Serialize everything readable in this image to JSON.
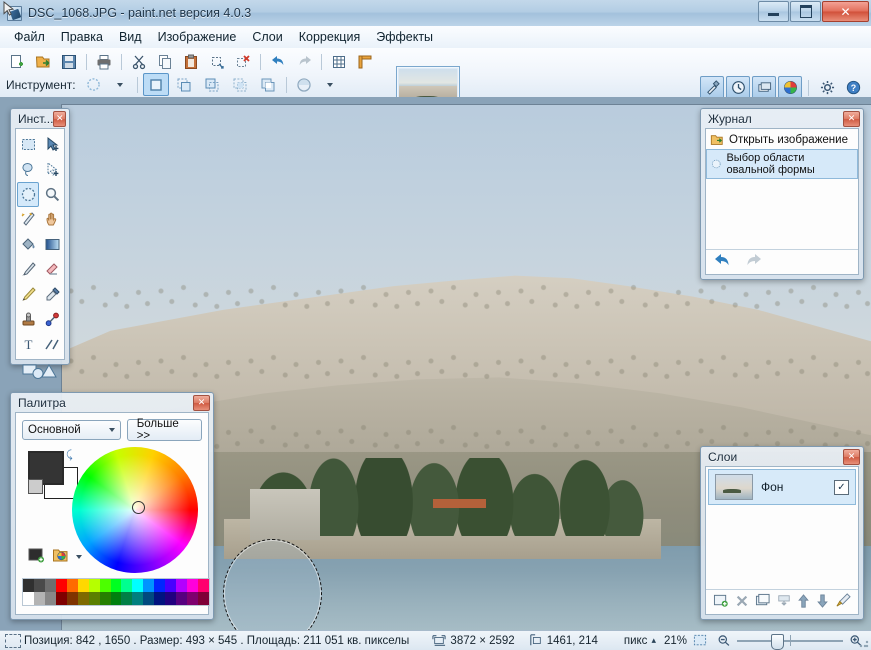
{
  "window": {
    "title": "DSC_1068.JPG - paint.net версия 4.0.3",
    "app_icon": "paintnet-icon",
    "minimize_label": "",
    "maximize_label": "",
    "close_label": "✕"
  },
  "menu": {
    "items": [
      {
        "label": "Файл",
        "name": "menu-file"
      },
      {
        "label": "Правка",
        "name": "menu-edit"
      },
      {
        "label": "Вид",
        "name": "menu-view"
      },
      {
        "label": "Изображение",
        "name": "menu-image"
      },
      {
        "label": "Слои",
        "name": "menu-layers"
      },
      {
        "label": "Коррекция",
        "name": "menu-adjustments"
      },
      {
        "label": "Эффекты",
        "name": "menu-effects"
      }
    ]
  },
  "toolbar": {
    "buttons": [
      {
        "name": "new-button",
        "icon": "new-document-icon"
      },
      {
        "name": "open-button",
        "icon": "open-folder-icon"
      },
      {
        "name": "save-button",
        "icon": "save-disk-icon"
      },
      {
        "name": "print-button",
        "icon": "printer-icon"
      },
      {
        "name": "cut-button",
        "icon": "scissors-icon"
      },
      {
        "name": "copy-button",
        "icon": "copy-icon"
      },
      {
        "name": "paste-button",
        "icon": "paste-icon"
      },
      {
        "name": "crop-button",
        "icon": "crop-icon"
      },
      {
        "name": "deselect-button",
        "icon": "deselect-icon"
      },
      {
        "name": "undo-button",
        "icon": "undo-arrow-icon"
      },
      {
        "name": "redo-button",
        "icon": "redo-arrow-icon"
      },
      {
        "name": "grid-button",
        "icon": "grid-icon"
      },
      {
        "name": "rulers-button",
        "icon": "rulers-icon"
      }
    ]
  },
  "tool_options": {
    "label": "Инструмент:",
    "tool_icon": "ellipse-select-icon",
    "selection_modes": [
      {
        "name": "selection-mode-replace",
        "icon": "select-replace-icon",
        "active": true
      },
      {
        "name": "selection-mode-union",
        "icon": "select-union-icon",
        "active": false
      },
      {
        "name": "selection-mode-exclude",
        "icon": "select-exclude-icon",
        "active": false
      },
      {
        "name": "selection-mode-intersect",
        "icon": "select-intersect-icon",
        "active": false
      },
      {
        "name": "selection-mode-xor",
        "icon": "select-xor-icon",
        "active": false
      }
    ],
    "antialias_icon": "antialias-icon"
  },
  "top_right_icons": [
    {
      "name": "tools-panel-toggle",
      "icon": "hammer-wrench-icon"
    },
    {
      "name": "history-panel-toggle",
      "icon": "clock-icon"
    },
    {
      "name": "layers-panel-toggle",
      "icon": "layers-stack-icon"
    },
    {
      "name": "palette-panel-toggle",
      "icon": "color-wheel-icon"
    },
    {
      "name": "settings-button",
      "icon": "gear-icon"
    },
    {
      "name": "help-button",
      "icon": "question-help-icon"
    }
  ],
  "document_tab": {
    "name": "document-thumbnail-tab",
    "tooltip": "DSC_1068.JPG"
  },
  "tools_panel": {
    "title": "Инст...",
    "close_label": "✕",
    "tools": [
      {
        "name": "tool-rectangle-select",
        "icon": "rectangle-select-icon",
        "active": false
      },
      {
        "name": "tool-move-selected",
        "icon": "move-selected-icon",
        "active": false
      },
      {
        "name": "tool-lasso-select",
        "icon": "lasso-select-icon",
        "active": false
      },
      {
        "name": "tool-move-selection",
        "icon": "move-selection-icon",
        "active": false
      },
      {
        "name": "tool-ellipse-select",
        "icon": "ellipse-select-icon",
        "active": true
      },
      {
        "name": "tool-zoom",
        "icon": "magnifier-icon",
        "active": false
      },
      {
        "name": "tool-magic-wand",
        "icon": "magic-wand-icon",
        "active": false
      },
      {
        "name": "tool-pan",
        "icon": "hand-pan-icon",
        "active": false
      },
      {
        "name": "tool-paint-bucket",
        "icon": "paint-bucket-icon",
        "active": false
      },
      {
        "name": "tool-gradient",
        "icon": "gradient-icon",
        "active": false
      },
      {
        "name": "tool-paintbrush",
        "icon": "paintbrush-icon",
        "active": false
      },
      {
        "name": "tool-eraser",
        "icon": "eraser-icon",
        "active": false
      },
      {
        "name": "tool-pencil",
        "icon": "pencil-icon",
        "active": false
      },
      {
        "name": "tool-color-picker",
        "icon": "eyedropper-icon",
        "active": false
      },
      {
        "name": "tool-clone-stamp",
        "icon": "clone-stamp-icon",
        "active": false
      },
      {
        "name": "tool-recolor",
        "icon": "recolor-icon",
        "active": false
      },
      {
        "name": "tool-text",
        "icon": "text-t-icon",
        "active": false
      },
      {
        "name": "tool-line-curve",
        "icon": "line-curve-icon",
        "active": false
      }
    ],
    "shapes_tool": {
      "name": "tool-shapes",
      "icon": "shapes-icon"
    }
  },
  "history_panel": {
    "title": "Журнал",
    "close_label": "✕",
    "items": [
      {
        "label": "Открыть изображение",
        "icon": "open-image-icon",
        "selected": false
      },
      {
        "label": "Выбор области овальной формы",
        "icon": "ellipse-select-icon",
        "selected": true
      }
    ],
    "undo_icon": "undo-arrow-icon",
    "redo_icon": "redo-arrow-icon"
  },
  "palette_panel": {
    "title": "Палитра",
    "close_label": "✕",
    "mode_select": {
      "value": "Основной",
      "name": "color-mode-select"
    },
    "more_button": {
      "label": "Больше >>",
      "name": "more-colors-button"
    },
    "primary_color": "#343434",
    "secondary_color": "#ffffff",
    "swap_icon": "swap-colors-icon",
    "reset_icon": "reset-colors-icon",
    "add_swatch_icon": "add-color-icon",
    "palette_file_icon": "palette-file-icon",
    "swatch_row_1": [
      "#303030",
      "#4a4a4a",
      "#6e6e6e",
      "#ff0000",
      "#ff6a00",
      "#ffd800",
      "#b6ff00",
      "#4cff00",
      "#00ff21",
      "#00ff90",
      "#00ffff",
      "#0094ff",
      "#0026ff",
      "#4800ff",
      "#b200ff",
      "#ff00dc",
      "#ff006e"
    ],
    "swatch_row_2": [
      "#ffffff",
      "#b4b4b4",
      "#888888",
      "#7f0000",
      "#7f3300",
      "#7f6a00",
      "#5b7f00",
      "#267f00",
      "#007f0e",
      "#007f46",
      "#007f7f",
      "#004a7f",
      "#00137f",
      "#21007f",
      "#57007f",
      "#7f006e",
      "#7f0037"
    ]
  },
  "layers_panel": {
    "title": "Слои",
    "close_label": "✕",
    "layers": [
      {
        "name": "Фон",
        "visible": true,
        "check_mark": "✓",
        "selected": true
      }
    ],
    "buttons": [
      {
        "name": "add-layer-button",
        "icon": "add-layer-icon"
      },
      {
        "name": "delete-layer-button",
        "icon": "delete-layer-icon"
      },
      {
        "name": "duplicate-layer-button",
        "icon": "duplicate-layer-icon"
      },
      {
        "name": "merge-layer-down-button",
        "icon": "merge-down-icon"
      },
      {
        "name": "move-layer-up-button",
        "icon": "arrow-up-icon"
      },
      {
        "name": "move-layer-down-button",
        "icon": "arrow-down-icon"
      },
      {
        "name": "layer-properties-button",
        "icon": "layer-properties-icon"
      }
    ]
  },
  "status_bar": {
    "selection_icon": "selection-icon",
    "cursor_info": "Позиция: 842 , 1650 . Размер: 493  × 545 . Площадь: 211 051 кв. пикселы",
    "image_size_icon": "image-size-icon",
    "image_size": "3872 × 2592",
    "cursor_pos_icon": "cursor-position-icon",
    "cursor_position": "1461, 214",
    "units_label": "пикс",
    "units_caret": "▴",
    "zoom_level": "21%",
    "fit_icon": "fit-to-window-icon",
    "zoom_out_icon": "zoom-out-icon",
    "zoom_in_icon": "zoom-in-icon"
  },
  "canvas": {
    "name": "image-canvas",
    "selection": {
      "name": "ellipse-selection",
      "shape": "ellipse"
    }
  }
}
